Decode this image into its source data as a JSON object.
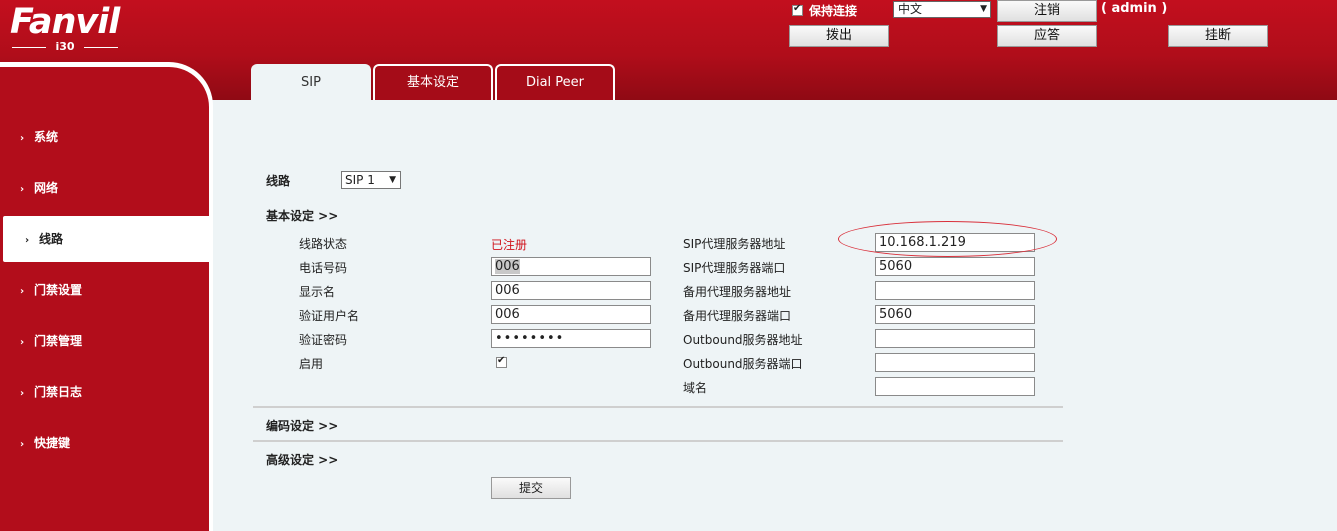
{
  "brand": {
    "logo_text": "Fanvil",
    "model": "i30"
  },
  "header": {
    "keep_connection": "保持连接",
    "language": "中文",
    "admin": "( admin )",
    "logout": "注销",
    "dial_out": "拨出",
    "answer": "应答",
    "hangup": "挂断"
  },
  "tabs": [
    {
      "label": "SIP",
      "active": true
    },
    {
      "label": "基本设定",
      "active": false
    },
    {
      "label": "Dial Peer",
      "active": false
    }
  ],
  "sidebar": {
    "items": [
      {
        "label": "系统"
      },
      {
        "label": "网络"
      },
      {
        "label": "线路",
        "active": true
      },
      {
        "label": "门禁设置"
      },
      {
        "label": "门禁管理"
      },
      {
        "label": "门禁日志"
      },
      {
        "label": "快捷键"
      }
    ]
  },
  "form": {
    "line_label": "线路",
    "line_value": "SIP 1",
    "basic_section": "基本设定 >>",
    "codec_section": "编码设定 >>",
    "advanced_section": "高级设定 >>",
    "left": {
      "line_status_label": "线路状态",
      "line_status_value": "已注册",
      "phone_label": "电话号码",
      "phone_value": "006",
      "display_name_label": "显示名",
      "display_name_value": "006",
      "auth_user_label": "验证用户名",
      "auth_user_value": "006",
      "auth_pass_label": "验证密码",
      "auth_pass_value": "••••••••",
      "enable_label": "启用"
    },
    "right": {
      "proxy_addr_label": "SIP代理服务器地址",
      "proxy_addr_value": "10.168.1.219",
      "proxy_port_label": "SIP代理服务器端口",
      "proxy_port_value": "5060",
      "backup_addr_label": "备用代理服务器地址",
      "backup_addr_value": "",
      "backup_port_label": "备用代理服务器端口",
      "backup_port_value": "5060",
      "outbound_addr_label": "Outbound服务器地址",
      "outbound_addr_value": "",
      "outbound_port_label": "Outbound服务器端口",
      "outbound_port_value": "",
      "domain_label": "域名",
      "domain_value": ""
    },
    "submit": "提交"
  },
  "colors": {
    "brand_red": "#b20d1b",
    "status_red": "#d0121b",
    "content_bg": "#eef4f6"
  }
}
